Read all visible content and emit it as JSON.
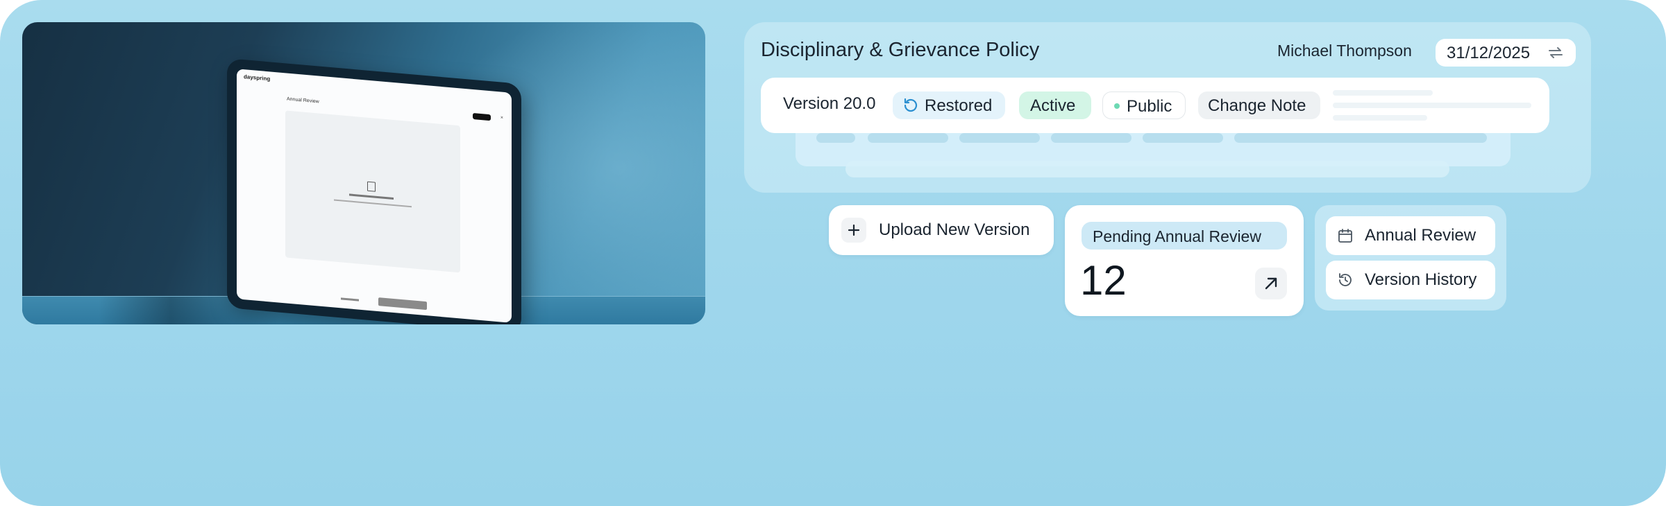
{
  "hero_image": {
    "tablet": {
      "logo": "dayspring",
      "dialog_title": "Annual Review"
    }
  },
  "policy": {
    "title": "Disciplinary & Grievance Policy",
    "author": "Michael Thompson",
    "date": "31/12/2025",
    "date_icon": "swap-arrows-icon",
    "version_label": "Version 20.0",
    "badges": {
      "restored": "Restored",
      "active": "Active",
      "public": "Public",
      "change_note": "Change Note"
    }
  },
  "actions": {
    "upload_label": "Upload New Version",
    "upload_icon": "plus-icon",
    "pending_label": "Pending Annual Review",
    "pending_count": "12",
    "pending_icon": "arrow-up-right-icon",
    "links": [
      {
        "label": "Annual Review",
        "icon": "calendar-icon"
      },
      {
        "label": "Version History",
        "icon": "history-icon"
      }
    ]
  },
  "colors": {
    "background": "#a9dcee",
    "active_badge": "#d3f5e6",
    "public_dot": "#6dd9b3",
    "restored_icon": "#2b8fd0",
    "pending_tag": "#cde9f6"
  }
}
